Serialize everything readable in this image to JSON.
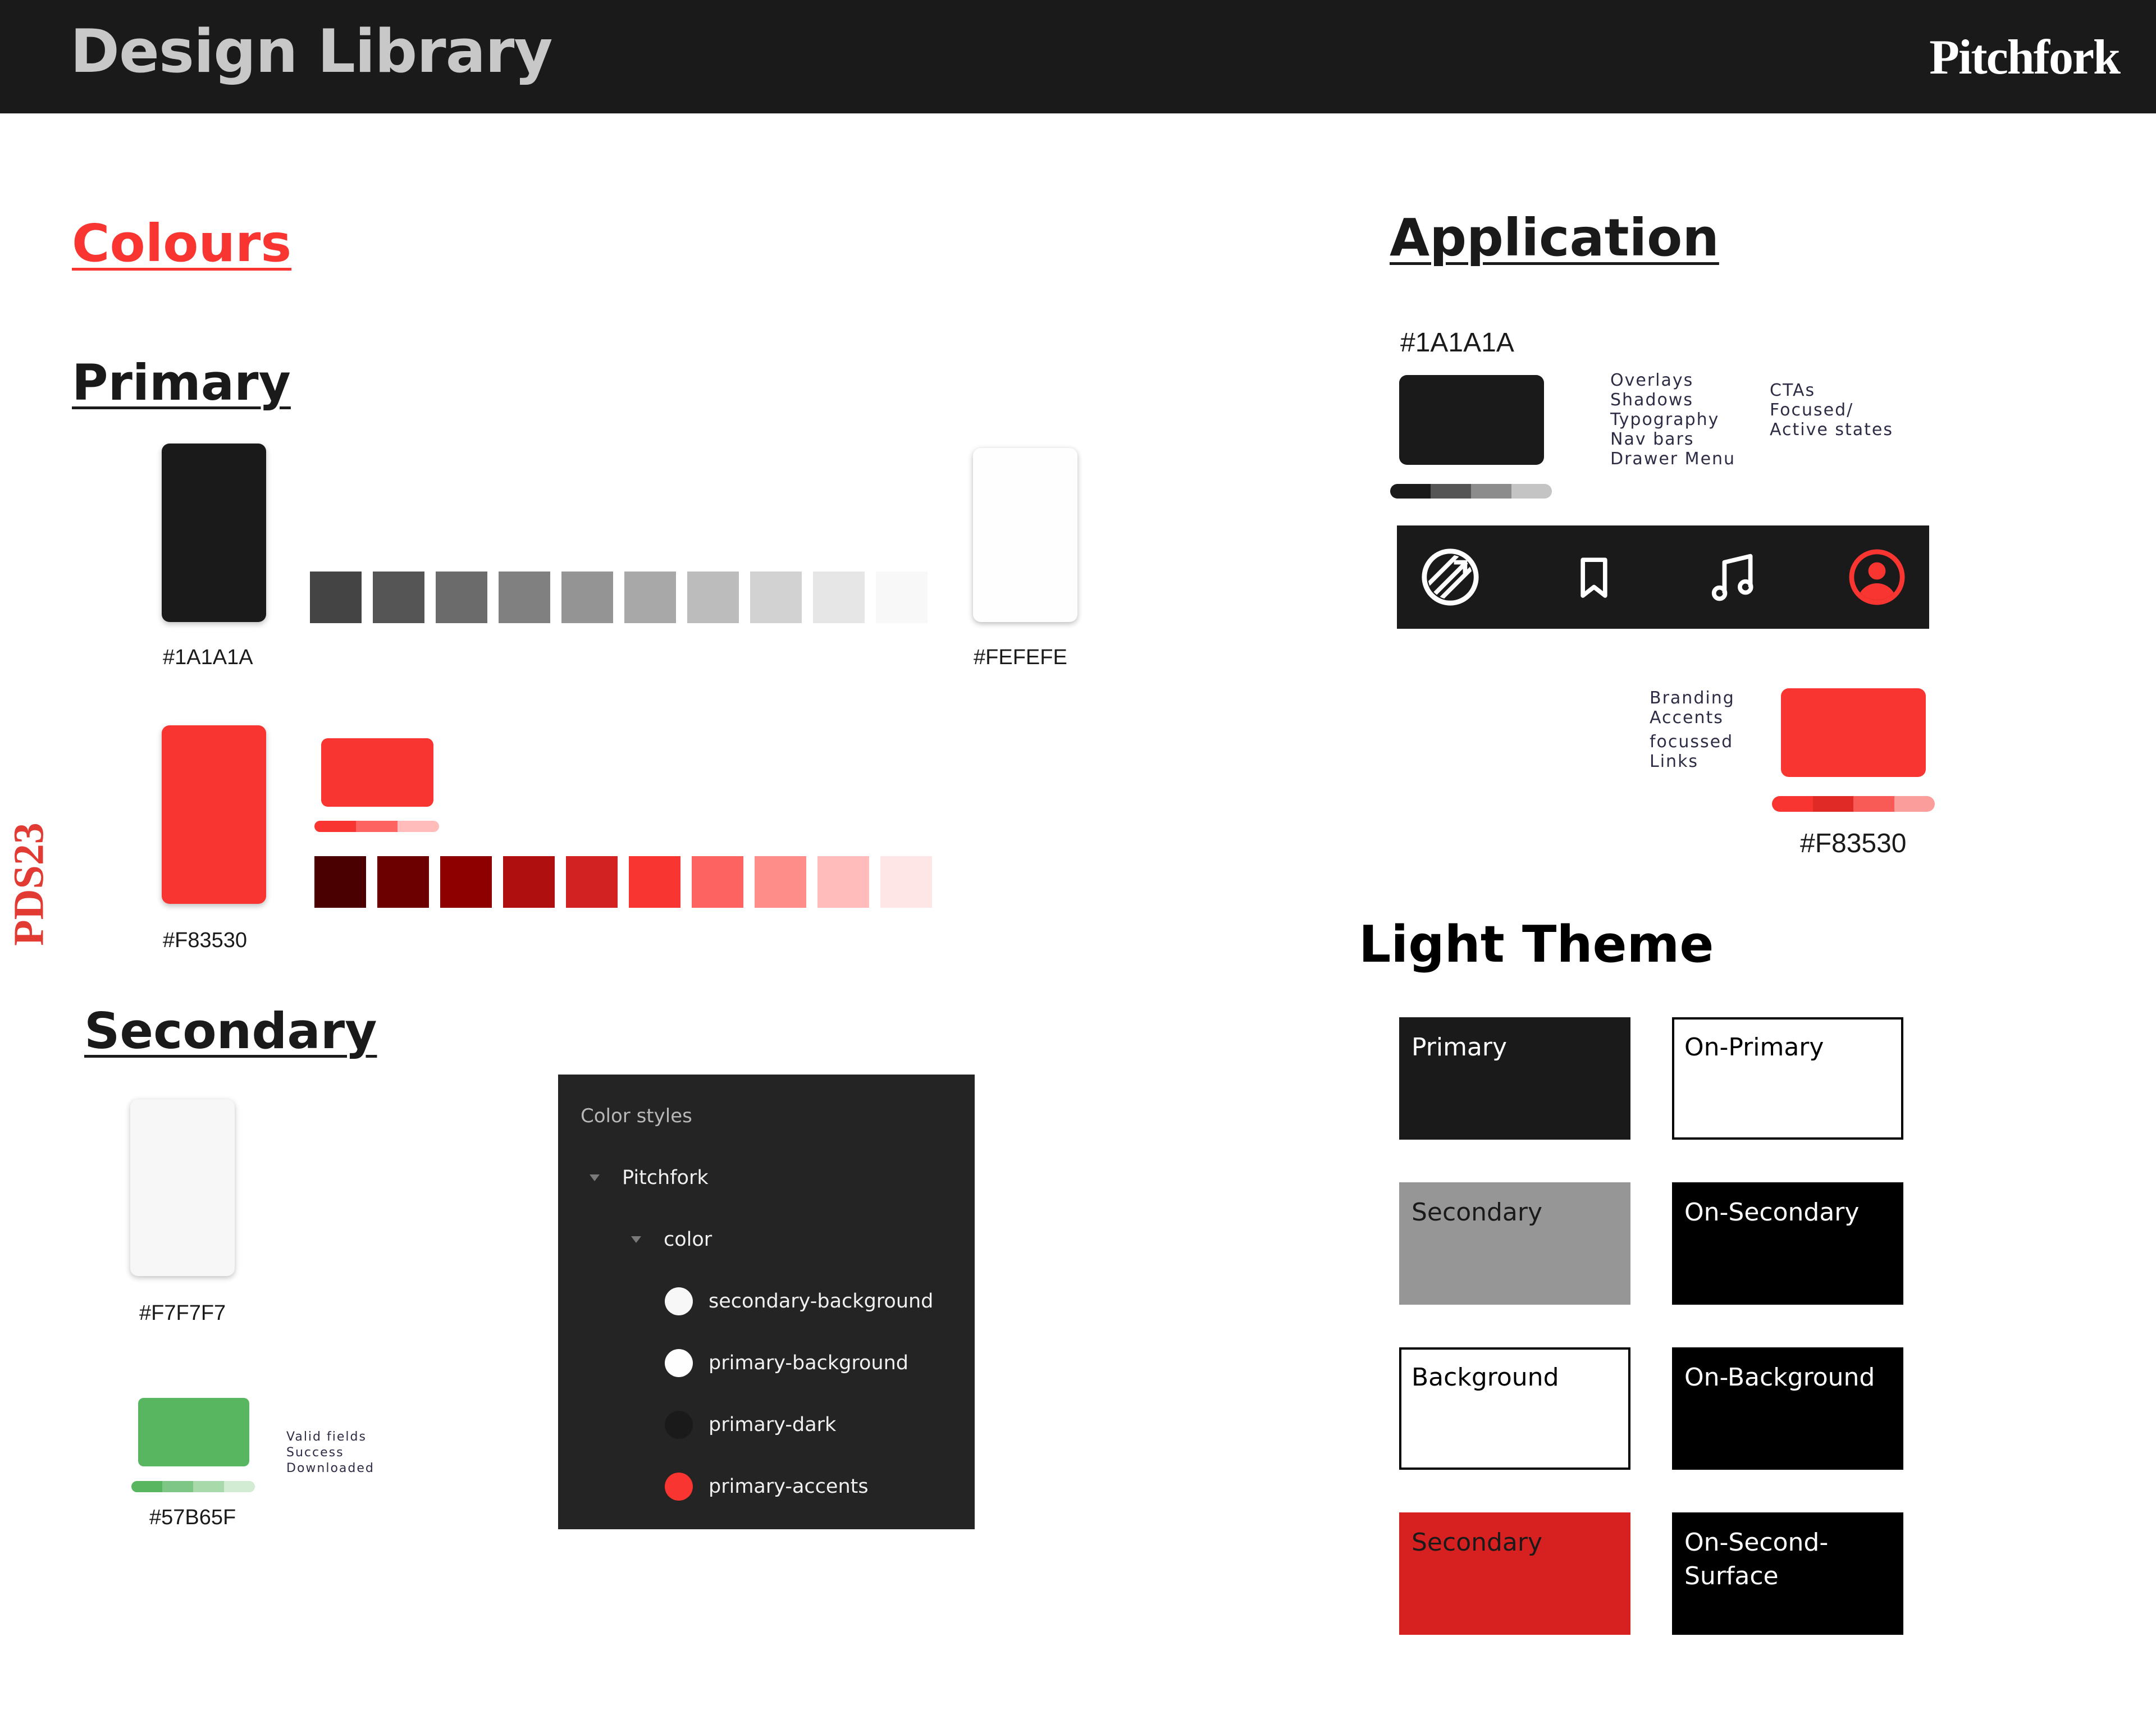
{
  "header": {
    "title": "Design Library",
    "brand": "Pitchfork"
  },
  "side_tag": "PDS23",
  "sections": {
    "colours": "Colours",
    "primary": "Primary",
    "secondary": "Secondary",
    "application": "Application",
    "light_theme": "Light Theme"
  },
  "primary": {
    "dark": {
      "hex": "#1A1A1A",
      "color": "#1a1a1a"
    },
    "light": {
      "hex": "#FEFEFE",
      "color": "#fefefe"
    },
    "gray_ramp": [
      "#444444",
      "#555555",
      "#6b6b6b",
      "#808080",
      "#949494",
      "#a8a8a8",
      "#bcbcbc",
      "#d2d2d2",
      "#e6e6e6",
      "#f8f8f8"
    ],
    "accent": {
      "hex": "#F83530",
      "color": "#f83530"
    },
    "red_ramp": [
      "#4a0000",
      "#6c0000",
      "#8e0000",
      "#b00f0f",
      "#d32222",
      "#f83530",
      "#fc6461",
      "#fe8d8a",
      "#ffbcbb",
      "#ffe6e6"
    ],
    "red_preview_bar": [
      "#f83530",
      "#fc6461",
      "#ffbcbb"
    ]
  },
  "secondary": {
    "light": {
      "hex": "#F7F7F7",
      "color": "#f7f7f7"
    },
    "green": {
      "hex": "#57B65F",
      "color": "#57b65f",
      "uses": [
        "Valid fields",
        "Success",
        "Downloaded"
      ]
    },
    "green_bar": [
      "#57b65f",
      "#7ec685",
      "#a7d9ab",
      "#d2ecd4"
    ]
  },
  "color_styles": {
    "title": "Color styles",
    "group": "Pitchfork",
    "subgroup": "color",
    "items": [
      {
        "name": "secondary-background",
        "color": "#f7f7f7"
      },
      {
        "name": "primary-background",
        "color": "#fefefe"
      },
      {
        "name": "primary-dark",
        "color": "#1a1a1a"
      },
      {
        "name": "primary-accents",
        "color": "#f83530"
      }
    ]
  },
  "application": {
    "dark": {
      "hex": "#1A1A1A",
      "color": "#1a1a1a",
      "uses": [
        "Overlays",
        "Shadows",
        "Typography",
        "Nav bars",
        "Drawer Menu"
      ],
      "states": [
        "CTAs",
        "Focused/",
        "Active states"
      ],
      "bar": [
        "#1a1a1a",
        "#555555",
        "#8c8c8c",
        "#c4c4c4"
      ]
    },
    "nav": {
      "icons": [
        "pitchfork-logo-icon",
        "bookmark-icon",
        "music-note-icon",
        "profile-icon"
      ],
      "icon_color": "#ffffff",
      "active_color": "#f83530"
    },
    "accent": {
      "hex": "#F83530",
      "color": "#f83530",
      "uses": [
        "Branding",
        "Accents",
        "focussed",
        "Links"
      ],
      "bar": [
        "#f83530",
        "#e02a25",
        "#f85a56",
        "#fb9e9b"
      ]
    }
  },
  "light_theme": {
    "cells": [
      {
        "label": "Primary",
        "bg": "#1a1a1a",
        "fg": "#ffffff",
        "border": "#1a1a1a"
      },
      {
        "label": "On-Primary",
        "bg": "#ffffff",
        "fg": "#000000",
        "border": "#000000"
      },
      {
        "label": "Secondary",
        "bg": "#969696",
        "fg": "#1a1a1a",
        "border": "#969696"
      },
      {
        "label": "On-Secondary",
        "bg": "#000000",
        "fg": "#ffffff",
        "border": "#000000"
      },
      {
        "label": "Background",
        "bg": "#ffffff",
        "fg": "#000000",
        "border": "#000000"
      },
      {
        "label": "On-Background",
        "bg": "#000000",
        "fg": "#ffffff",
        "border": "#000000"
      },
      {
        "label": "Secondary",
        "bg": "#d72020",
        "fg": "#1a1a1a",
        "border": "#d72020"
      },
      {
        "label": "On-Second-\nSurface",
        "bg": "#000000",
        "fg": "#ffffff",
        "border": "#000000"
      }
    ]
  }
}
